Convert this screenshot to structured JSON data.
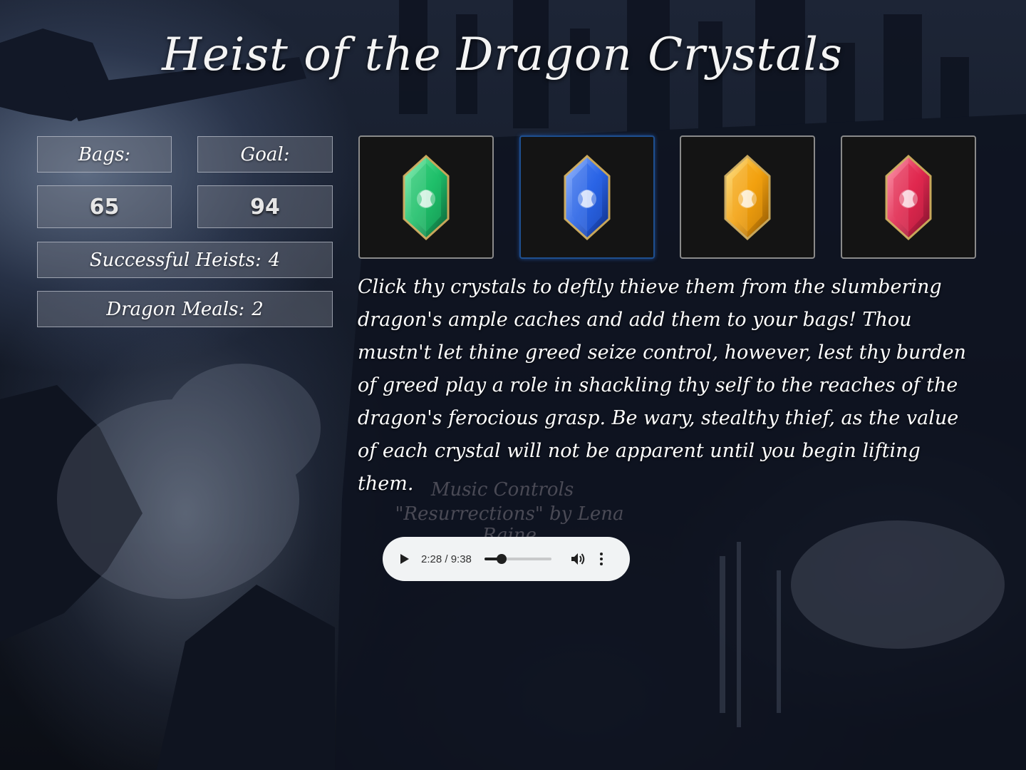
{
  "game": {
    "title": "Heist of the Dragon Crystals"
  },
  "stats": {
    "bags_label": "Bags:",
    "goal_label": "Goal:",
    "bags_value": "65",
    "goal_value": "94",
    "heists_label": "Successful Heists:",
    "heists_value": "4",
    "meals_label": "Dragon Meals:",
    "meals_value": "2"
  },
  "crystals": [
    {
      "name": "green-crystal",
      "color": "#1fbf6a",
      "light": "#7ff0b0",
      "dark": "#0b5a33"
    },
    {
      "name": "blue-crystal",
      "color": "#2a64e6",
      "light": "#8fb4ff",
      "dark": "#0d2a80",
      "selected": true
    },
    {
      "name": "yellow-crystal",
      "color": "#f2a10f",
      "light": "#ffe07a",
      "dark": "#8a5200"
    },
    {
      "name": "red-crystal",
      "color": "#e0284f",
      "light": "#ff8fa6",
      "dark": "#7a0f2a"
    }
  ],
  "description": "Click thy crystals to deftly thieve them from the slumbering dragon's ample caches and add them to your bags! Thou mustn't let thine greed seize control, however, lest thy burden of greed play a role in shackling thy self to the reaches of the dragon's ferocious grasp. Be wary, stealthy thief, as the value of each crystal will not be apparent until you begin lifting them.",
  "music": {
    "heading": "Music Controls",
    "credit": "\"Resurrections\" by Lena Raine",
    "time_display": "2:28 / 9:38",
    "progress_fraction": 0.256
  }
}
